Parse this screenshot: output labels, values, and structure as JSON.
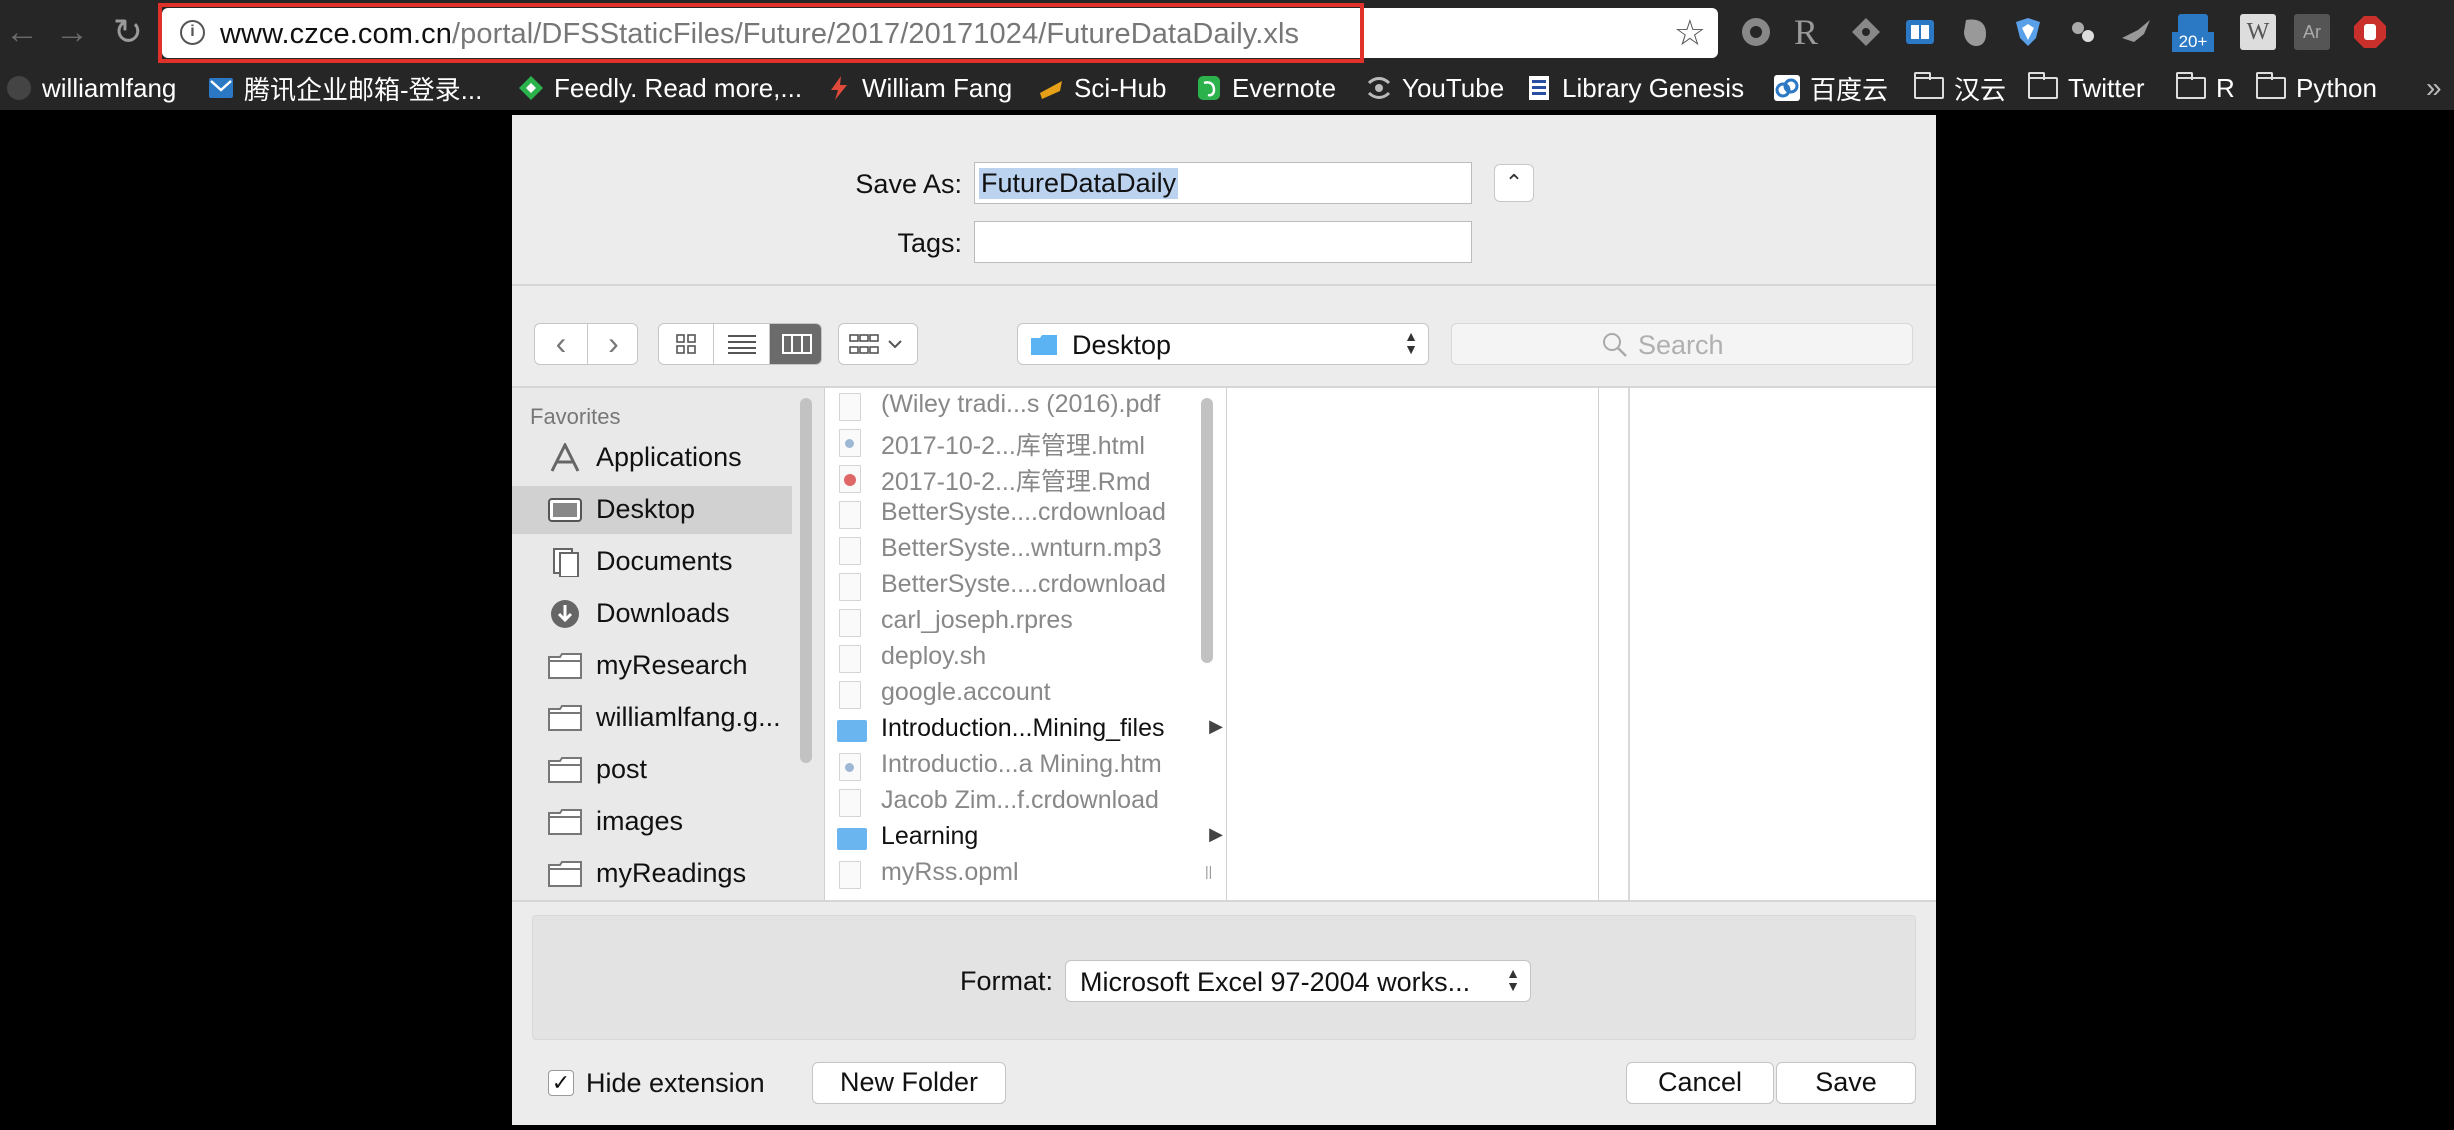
{
  "browser": {
    "url_host": "www.czce.com.cn",
    "url_path": "/portal/DFSStaticFiles/Future/2017/20171024/FutureDataDaily.xls",
    "extension_badge": "20+"
  },
  "bookmarks": [
    {
      "label": "williamlfang"
    },
    {
      "label": "腾讯企业邮箱-登录..."
    },
    {
      "label": "Feedly. Read more,..."
    },
    {
      "label": "William Fang"
    },
    {
      "label": "Sci-Hub"
    },
    {
      "label": "Evernote"
    },
    {
      "label": "YouTube"
    },
    {
      "label": "Library Genesis"
    },
    {
      "label": "百度云"
    },
    {
      "label": "汉云"
    },
    {
      "label": "Twitter"
    },
    {
      "label": "R"
    },
    {
      "label": "Python"
    }
  ],
  "overflow_chevron": "»",
  "dialog": {
    "save_as_label": "Save As:",
    "save_as_value": "FutureDataDaily",
    "tags_label": "Tags:",
    "tags_value": "",
    "location": "Desktop",
    "search_placeholder": "Search",
    "sidebar_heading": "Favorites",
    "sidebar": [
      {
        "label": "Applications",
        "icon": "applications-icon"
      },
      {
        "label": "Desktop",
        "icon": "desktop-icon",
        "selected": true
      },
      {
        "label": "Documents",
        "icon": "documents-icon"
      },
      {
        "label": "Downloads",
        "icon": "downloads-icon"
      },
      {
        "label": "myResearch",
        "icon": "folder-icon"
      },
      {
        "label": "williamlfang.g...",
        "icon": "folder-icon"
      },
      {
        "label": "post",
        "icon": "folder-icon"
      },
      {
        "label": "images",
        "icon": "folder-icon"
      },
      {
        "label": "myReadings",
        "icon": "folder-icon"
      }
    ],
    "files": [
      {
        "name": "(Wiley tradi...s (2016).pdf",
        "kind": "pdf"
      },
      {
        "name": "2017-10-2...库管理.html",
        "kind": "html"
      },
      {
        "name": "2017-10-2...库管理.Rmd",
        "kind": "rmd"
      },
      {
        "name": "BetterSyste....crdownload",
        "kind": "doc"
      },
      {
        "name": "BetterSyste...wnturn.mp3",
        "kind": "mp3"
      },
      {
        "name": "BetterSyste....crdownload",
        "kind": "doc"
      },
      {
        "name": "carl_joseph.rpres",
        "kind": "doc"
      },
      {
        "name": "deploy.sh",
        "kind": "doc"
      },
      {
        "name": "google.account",
        "kind": "doc"
      },
      {
        "name": "Introduction...Mining_files",
        "kind": "folder"
      },
      {
        "name": "Introductio...a Mining.htm",
        "kind": "html"
      },
      {
        "name": "Jacob Zim...f.crdownload",
        "kind": "doc"
      },
      {
        "name": "Learning",
        "kind": "folder"
      },
      {
        "name": "myRss.opml",
        "kind": "doc"
      }
    ],
    "format_label": "Format:",
    "format_value": "Microsoft Excel 97-2004 works...",
    "hide_extension_label": "Hide extension",
    "hide_extension_checked": true,
    "new_folder_label": "New Folder",
    "cancel_label": "Cancel",
    "save_label": "Save"
  }
}
